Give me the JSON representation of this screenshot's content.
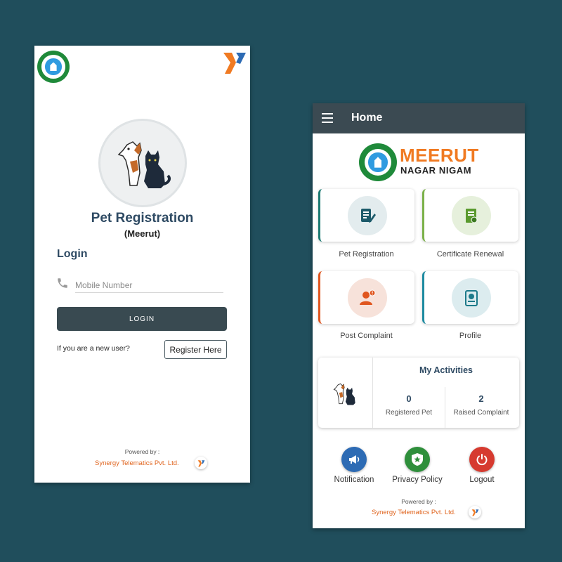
{
  "login": {
    "app_title": "Pet Registration",
    "app_subtitle": "(Meerut)",
    "heading": "Login",
    "mobile_placeholder": "Mobile Number",
    "login_button": "LOGIN",
    "new_user_prompt": "If you are a new user?",
    "register_button": "Register Here",
    "powered_by": "Powered by :",
    "company": "Synergy Telematics Pvt. Ltd."
  },
  "home": {
    "title": "Home",
    "city_name": "MEERUT",
    "city_body": "NAGAR NIGAM",
    "tiles": [
      {
        "label": "Pet Registration",
        "icon": "form-pen-icon",
        "accent": "#1c7a73"
      },
      {
        "label": "Certificate Renewal",
        "icon": "certificate-icon",
        "accent": "#7ab048"
      },
      {
        "label": "Post Complaint",
        "icon": "complaint-user-icon",
        "accent": "#e0561f"
      },
      {
        "label": "Profile",
        "icon": "profile-card-icon",
        "accent": "#1c8aa0"
      }
    ],
    "activities": {
      "title": "My Activities",
      "registered_pet_count": "0",
      "registered_pet_label": "Registered Pet",
      "raised_complaint_count": "2",
      "raised_complaint_label": "Raised Complaint"
    },
    "actions": [
      {
        "label": "Notification",
        "icon": "megaphone-icon",
        "color": "#2d6bb4"
      },
      {
        "label": "Privacy Policy",
        "icon": "shield-star-icon",
        "color": "#2e8f3b"
      },
      {
        "label": "Logout",
        "icon": "power-icon",
        "color": "#d63a2f"
      }
    ],
    "powered_by": "Powered by :",
    "company": "Synergy Telematics Pvt. Ltd."
  },
  "colors": {
    "background": "#204e5c",
    "app_bar": "#3b4a52",
    "title_text": "#2e4a63",
    "brand_orange": "#f07a22",
    "company_orange": "#e0651f"
  }
}
